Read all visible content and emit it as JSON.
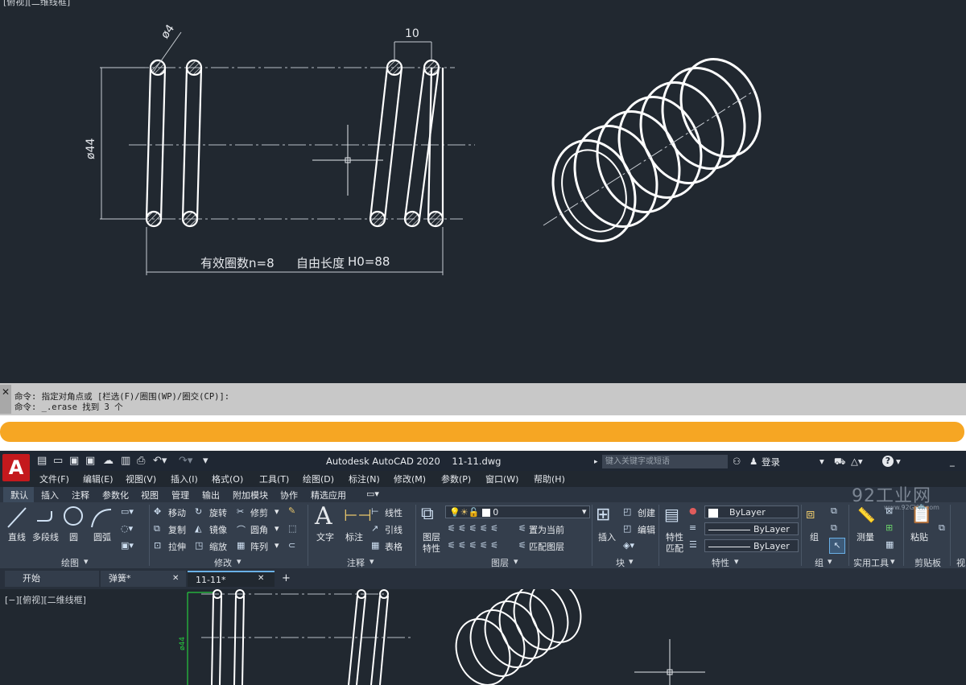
{
  "drawing_top": {
    "viewport_label": "[俯视][二维线框]",
    "dim_wire_diameter": "ø4",
    "dim_pitch": "10",
    "dim_outer_diameter": "ø44",
    "note_coils": "有效圈数n=8",
    "note_free_length_prefix": "自由长度",
    "note_free_length_value": "H0=88"
  },
  "command_line": {
    "close": "✕",
    "line1": "命令: 指定对角点或 [栏选(F)/圈围(WP)/圈交(CP)]:",
    "line2": "命令: _.erase 找到 3 个"
  },
  "title_bar": {
    "app_title": "Autodesk AutoCAD 2020",
    "file_name": "11-11.dwg",
    "search_placeholder": "键入关键字或短语",
    "sign_in": "登录",
    "help": "?"
  },
  "menu": [
    "文件(F)",
    "编辑(E)",
    "视图(V)",
    "插入(I)",
    "格式(O)",
    "工具(T)",
    "绘图(D)",
    "标注(N)",
    "修改(M)",
    "参数(P)",
    "窗口(W)",
    "帮助(H)"
  ],
  "ribbon_tabs": [
    "默认",
    "插入",
    "注释",
    "参数化",
    "视图",
    "管理",
    "输出",
    "附加模块",
    "协作",
    "精选应用"
  ],
  "ribbon": {
    "draw": {
      "title": "绘图",
      "line": "直线",
      "polyline": "多段线",
      "circle": "圆",
      "arc": "圆弧"
    },
    "modify": {
      "title": "修改",
      "move": "移动",
      "rotate": "旋转",
      "trim": "修剪",
      "copy": "复制",
      "mirror": "镜像",
      "fillet": "圆角",
      "stretch": "拉伸",
      "scale": "缩放",
      "array": "阵列"
    },
    "annotation": {
      "title": "注释",
      "text": "文字",
      "dimension": "标注",
      "linear": "线性",
      "leader": "引线",
      "table": "表格"
    },
    "layers": {
      "title": "图层",
      "layer_props_1": "图层",
      "layer_props_2": "特性",
      "layer_value": "0",
      "set_current": "置为当前",
      "match_layer": "匹配图层"
    },
    "block": {
      "title": "块",
      "insert": "插入",
      "create": "创建",
      "edit": "编辑"
    },
    "properties": {
      "title": "特性",
      "match_1": "特性",
      "match_2": "匹配",
      "color": "ByLayer",
      "linetype": "ByLayer",
      "lineweight": "ByLayer"
    },
    "groups": {
      "title": "组",
      "group": "组"
    },
    "utilities": {
      "title": "实用工具",
      "measure": "测量"
    },
    "clipboard": {
      "title": "剪贴板",
      "paste": "粘贴"
    },
    "view_cut": "视"
  },
  "doc_tabs": {
    "start": "开始",
    "tab1": "弹簧*",
    "tab2": "11-11*",
    "close": "✕",
    "add": "+"
  },
  "drawing_bottom": {
    "viewport_label": "[−][俯视][二维线框]",
    "dim_outer_diameter": "ø44"
  },
  "watermark": {
    "text": "92工业网",
    "url": "www.92GYW.com"
  }
}
